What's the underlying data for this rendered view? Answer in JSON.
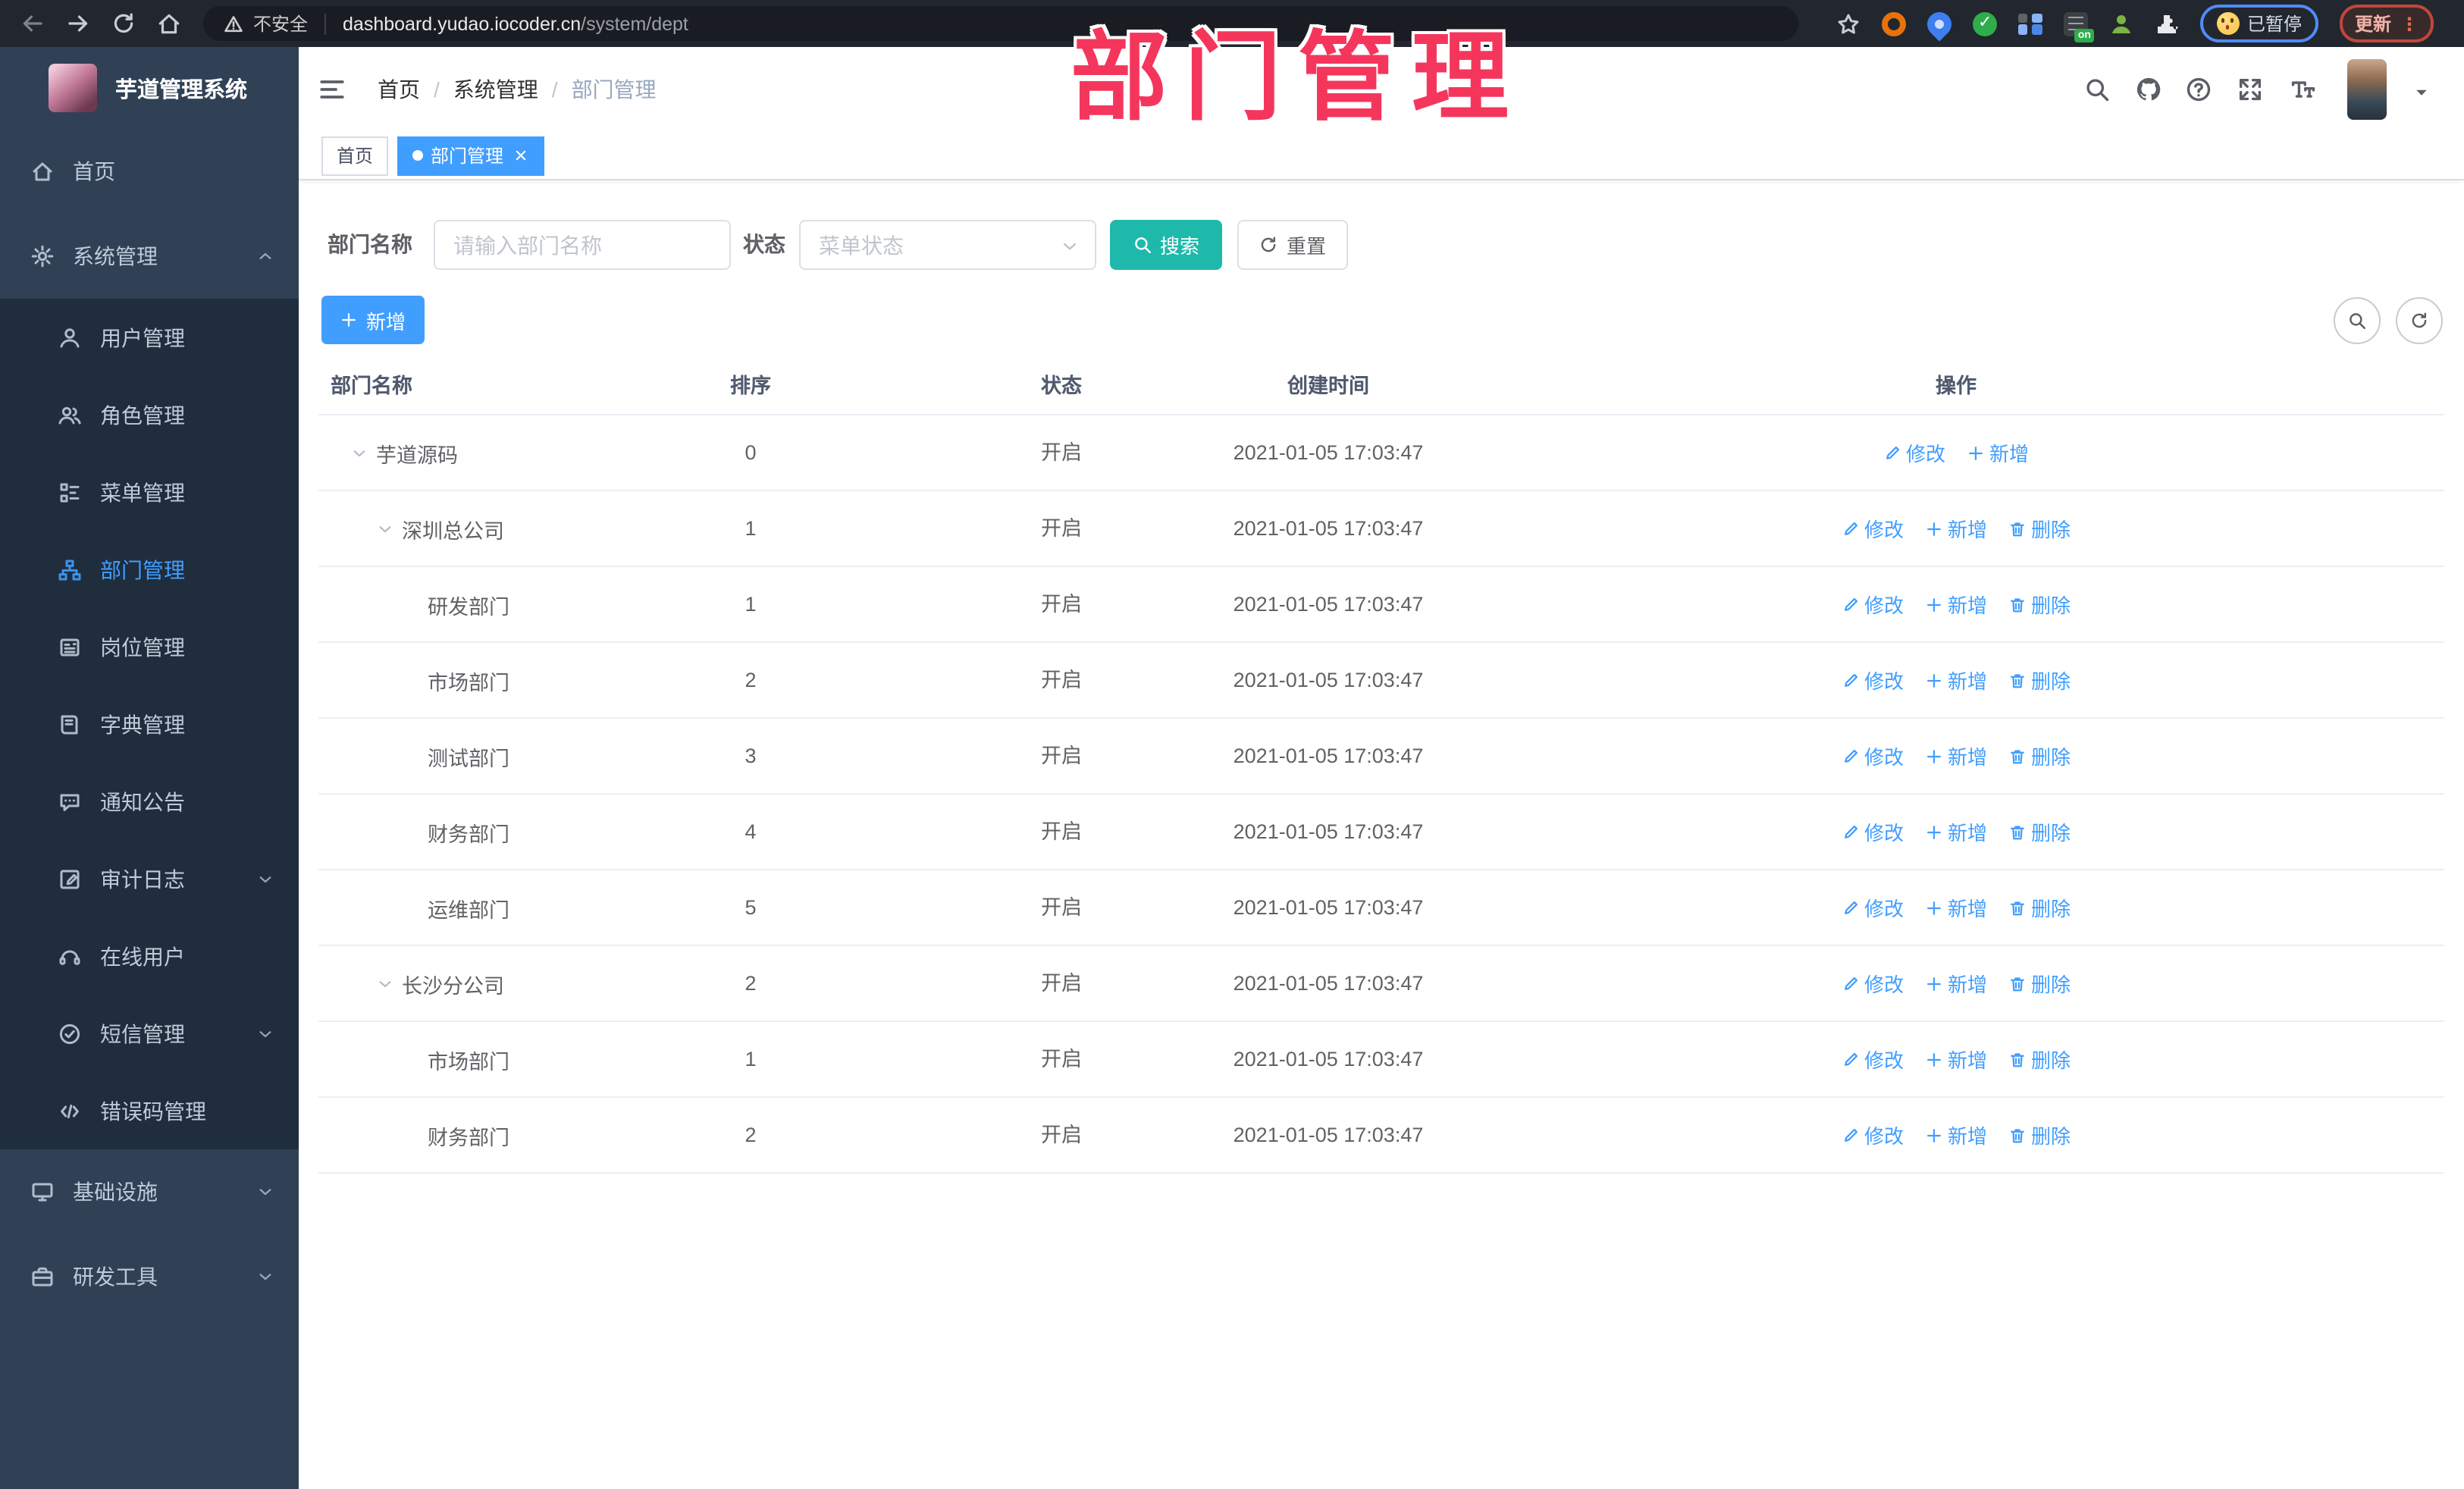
{
  "browser": {
    "security_label": "不安全",
    "url_host": "dashboard.yudao.iocoder.cn",
    "url_path": "/system/dept",
    "paused_label": "已暂停",
    "update_label": "更新"
  },
  "overlay_title": "部门管理",
  "sidebar": {
    "logo_title": "芋道管理系统",
    "menu": [
      {
        "label": "首页",
        "kind": "top",
        "icon": "home",
        "arrow": ""
      },
      {
        "label": "系统管理",
        "kind": "top",
        "icon": "gear",
        "arrow": "chevron-up"
      },
      {
        "label": "用户管理",
        "kind": "sub",
        "icon": "user",
        "arrow": ""
      },
      {
        "label": "角色管理",
        "kind": "sub",
        "icon": "users",
        "arrow": ""
      },
      {
        "label": "菜单管理",
        "kind": "sub",
        "icon": "menu",
        "arrow": ""
      },
      {
        "label": "部门管理",
        "kind": "sub",
        "icon": "org",
        "arrow": "",
        "active": true
      },
      {
        "label": "岗位管理",
        "kind": "sub",
        "icon": "badge",
        "arrow": ""
      },
      {
        "label": "字典管理",
        "kind": "sub",
        "icon": "book",
        "arrow": ""
      },
      {
        "label": "通知公告",
        "kind": "sub",
        "icon": "announce",
        "arrow": ""
      },
      {
        "label": "审计日志",
        "kind": "sub",
        "icon": "log",
        "arrow": "chevron-down"
      },
      {
        "label": "在线用户",
        "kind": "sub",
        "icon": "online",
        "arrow": ""
      },
      {
        "label": "短信管理",
        "kind": "sub",
        "icon": "sms",
        "arrow": "chevron-down"
      },
      {
        "label": "错误码管理",
        "kind": "sub",
        "icon": "code",
        "arrow": ""
      },
      {
        "label": "基础设施",
        "kind": "top",
        "icon": "monitor",
        "arrow": "chevron-down"
      },
      {
        "label": "研发工具",
        "kind": "top",
        "icon": "toolbox",
        "arrow": "chevron-down"
      }
    ]
  },
  "header": {
    "breadcrumb": [
      "首页",
      "系统管理",
      "部门管理"
    ]
  },
  "tabs": [
    {
      "label": "首页"
    },
    {
      "label": "部门管理"
    }
  ],
  "filters": {
    "dept_label": "部门名称",
    "dept_placeholder": "请输入部门名称",
    "status_label": "状态",
    "status_placeholder": "菜单状态",
    "search_label": "搜索",
    "reset_label": "重置"
  },
  "toolbar": {
    "add_label": "新增"
  },
  "table": {
    "columns": [
      "部门名称",
      "排序",
      "状态",
      "创建时间",
      "操作"
    ],
    "action_labels": {
      "edit": "修改",
      "add": "新增",
      "delete": "删除"
    },
    "rows": [
      {
        "name": "芋道源码",
        "level": 0,
        "expandable": true,
        "sort": "0",
        "status": "开启",
        "created": "2021-01-05 17:03:47",
        "can_delete": false
      },
      {
        "name": "深圳总公司",
        "level": 1,
        "expandable": true,
        "sort": "1",
        "status": "开启",
        "created": "2021-01-05 17:03:47",
        "can_delete": true
      },
      {
        "name": "研发部门",
        "level": 2,
        "expandable": false,
        "sort": "1",
        "status": "开启",
        "created": "2021-01-05 17:03:47",
        "can_delete": true
      },
      {
        "name": "市场部门",
        "level": 2,
        "expandable": false,
        "sort": "2",
        "status": "开启",
        "created": "2021-01-05 17:03:47",
        "can_delete": true
      },
      {
        "name": "测试部门",
        "level": 2,
        "expandable": false,
        "sort": "3",
        "status": "开启",
        "created": "2021-01-05 17:03:47",
        "can_delete": true
      },
      {
        "name": "财务部门",
        "level": 2,
        "expandable": false,
        "sort": "4",
        "status": "开启",
        "created": "2021-01-05 17:03:47",
        "can_delete": true
      },
      {
        "name": "运维部门",
        "level": 2,
        "expandable": false,
        "sort": "5",
        "status": "开启",
        "created": "2021-01-05 17:03:47",
        "can_delete": true
      },
      {
        "name": "长沙分公司",
        "level": 1,
        "expandable": true,
        "sort": "2",
        "status": "开启",
        "created": "2021-01-05 17:03:47",
        "can_delete": true
      },
      {
        "name": "市场部门",
        "level": 2,
        "expandable": false,
        "sort": "1",
        "status": "开启",
        "created": "2021-01-05 17:03:47",
        "can_delete": true
      },
      {
        "name": "财务部门",
        "level": 2,
        "expandable": false,
        "sort": "2",
        "status": "开启",
        "created": "2021-01-05 17:03:47",
        "can_delete": true
      }
    ]
  }
}
